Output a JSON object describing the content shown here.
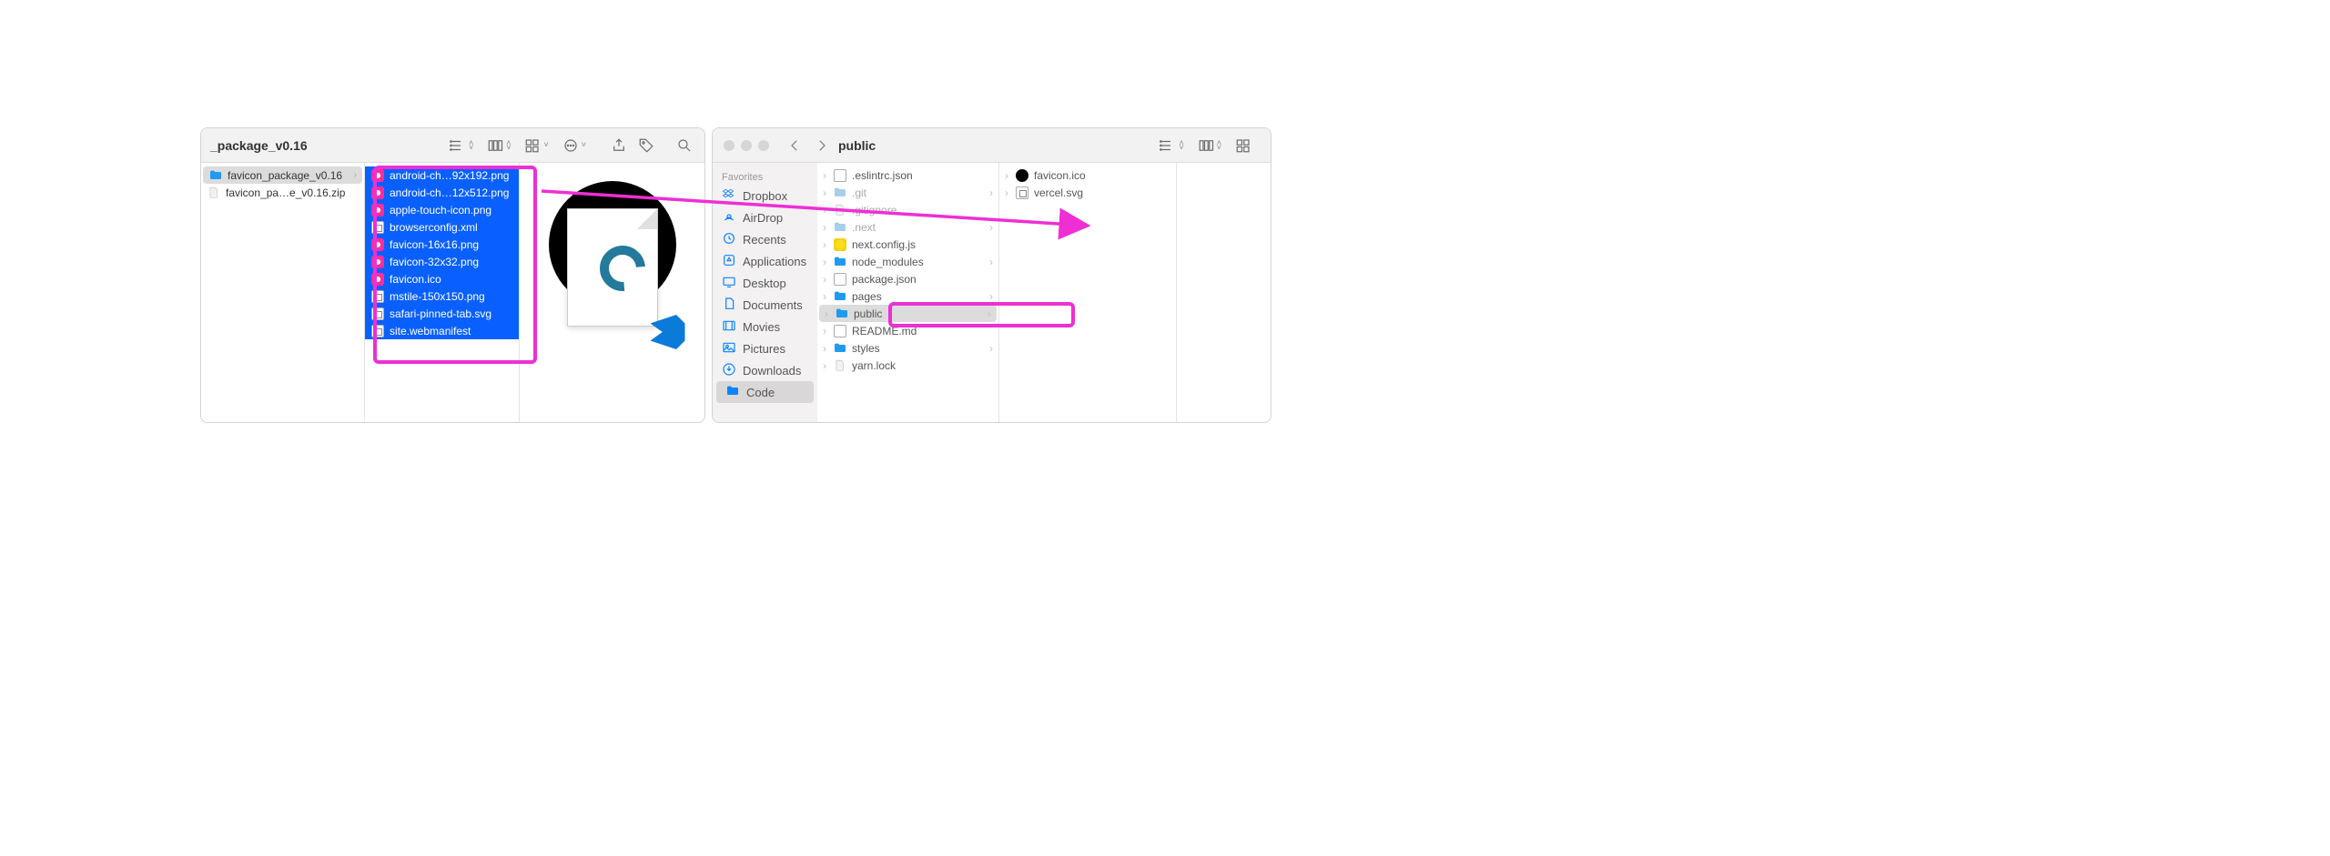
{
  "left_finder": {
    "title": "_package_v0.16",
    "col1": [
      {
        "name": "favicon_package_v0.16",
        "icon": "folder",
        "selected": "grey",
        "expand": true
      },
      {
        "name": "favicon_pa…e_v0.16.zip",
        "icon": "file"
      }
    ],
    "col2": [
      {
        "name": "android-ch…92x192.png",
        "icon": "png"
      },
      {
        "name": "android-ch…12x512.png",
        "icon": "png"
      },
      {
        "name": "apple-touch-icon.png",
        "icon": "png"
      },
      {
        "name": "browserconfig.xml",
        "icon": "xml"
      },
      {
        "name": "favicon-16x16.png",
        "icon": "png"
      },
      {
        "name": "favicon-32x32.png",
        "icon": "png"
      },
      {
        "name": "favicon.ico",
        "icon": "png"
      },
      {
        "name": "mstile-150x150.png",
        "icon": "xml"
      },
      {
        "name": "safari-pinned-tab.svg",
        "icon": "xml"
      },
      {
        "name": "site.webmanifest",
        "icon": "manifest"
      }
    ]
  },
  "right_finder": {
    "title": "public",
    "sidebar_header": "Favorites",
    "sidebar": [
      {
        "name": "Dropbox",
        "icon": "dropbox"
      },
      {
        "name": "AirDrop",
        "icon": "airdrop"
      },
      {
        "name": "Recents",
        "icon": "recents"
      },
      {
        "name": "Applications",
        "icon": "apps"
      },
      {
        "name": "Desktop",
        "icon": "desktop"
      },
      {
        "name": "Documents",
        "icon": "docs"
      },
      {
        "name": "Movies",
        "icon": "movies"
      },
      {
        "name": "Pictures",
        "icon": "pictures"
      },
      {
        "name": "Downloads",
        "icon": "downloads"
      },
      {
        "name": "Code",
        "icon": "folder",
        "active": true
      }
    ],
    "col1": [
      {
        "name": ".eslintrc.json",
        "icon": "json"
      },
      {
        "name": ".git",
        "icon": "folder",
        "dim": true,
        "expand": true
      },
      {
        "name": ".gitignore",
        "icon": "file",
        "dim": true
      },
      {
        "name": ".next",
        "icon": "folder",
        "dim": true,
        "expand": true
      },
      {
        "name": "next.config.js",
        "icon": "js"
      },
      {
        "name": "node_modules",
        "icon": "folder",
        "expand": true
      },
      {
        "name": "package.json",
        "icon": "json"
      },
      {
        "name": "pages",
        "icon": "folder",
        "expand": true
      },
      {
        "name": "public",
        "icon": "folder",
        "selected": true,
        "expand": true
      },
      {
        "name": "README.md",
        "icon": "md"
      },
      {
        "name": "styles",
        "icon": "folder",
        "expand": true
      },
      {
        "name": "yarn.lock",
        "icon": "file"
      }
    ],
    "col2": [
      {
        "name": "favicon.ico",
        "icon": "black-ico"
      },
      {
        "name": "vercel.svg",
        "icon": "svg"
      }
    ]
  },
  "annotation_color": "#ee2fd4"
}
